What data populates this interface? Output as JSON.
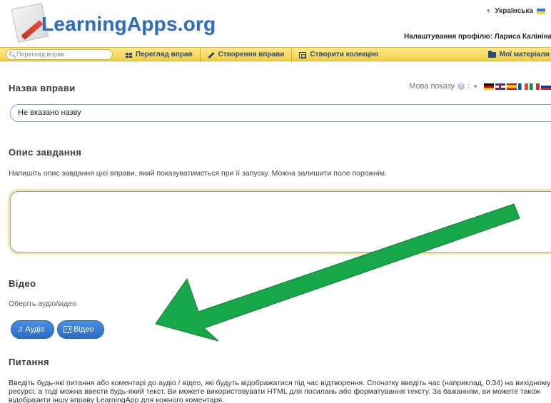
{
  "header": {
    "logo_text": "LearningApps.org",
    "language": "Українська",
    "profile": "Налаштування профілю: Лариса Калініна"
  },
  "navbar": {
    "search_placeholder": "Перегляд вправ",
    "items": [
      {
        "label": "Перегляд вправ",
        "icon": "grid-icon"
      },
      {
        "label": "Створення вправи",
        "icon": "pencil-icon"
      },
      {
        "label": "Створити колекцію",
        "icon": "collection-icon"
      }
    ],
    "right_item": {
      "label": "Мої матеріали",
      "icon": "folder-icon"
    }
  },
  "title_section": {
    "heading": "Назва вправи",
    "language_label": "Мова показу",
    "help_symbol": "?",
    "flags": [
      "de",
      "uk",
      "es",
      "fr",
      "it",
      "ru"
    ],
    "input_value": "Не вказано назву"
  },
  "description_section": {
    "heading": "Опис завдання",
    "hint": "Напишіть опис завдання цієї вправи, який показуватиметься при її запуску. Можна залишити поле порожнім.",
    "textarea_value": ""
  },
  "video_section": {
    "heading": "Відео",
    "subtitle": "Оберіть аудіо/відео",
    "audio_button": "Аудіо",
    "video_button": "Відео"
  },
  "questions_section": {
    "heading": "Питання",
    "text": "Введіть будь-які питання або коментарі до аудіо / відео, які будуть відображатися під час відтворення. Спочатку введіть час (наприклад, 0:34) на вихідному ресурсі, а тоді можна ввести будь-який текст. Ви можете використовувати HTML для посилань або форматування тексту. За бажанням, ви можете також відобразити іншу вправу LearningApp для кожного коментаря."
  },
  "colors": {
    "logo_blue": "#2f6db5",
    "navbar_yellow": "#f4cf45",
    "button_blue": "#2b6cc4",
    "arrow_green": "#17a84a"
  }
}
